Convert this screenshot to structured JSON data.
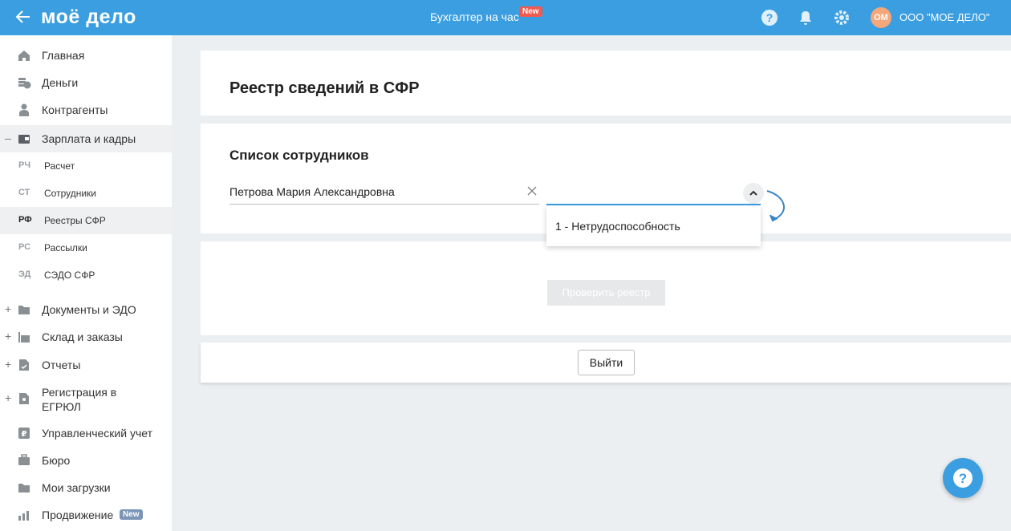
{
  "header": {
    "logo": "моё дело",
    "center_link": "Бухгалтер на час",
    "new_badge": "New",
    "avatar_initials": "ОМ",
    "company": "ООО \"МОЕ ДЕЛО\"",
    "accent": "#3a9ee0"
  },
  "sidebar": {
    "items": [
      {
        "label": "Главная",
        "icon": "home-icon"
      },
      {
        "label": "Деньги",
        "icon": "money-icon"
      },
      {
        "label": "Контрагенты",
        "icon": "contractors-icon"
      },
      {
        "label": "Зарплата и кадры",
        "icon": "wallet-icon",
        "expand": "–"
      }
    ],
    "subitems": [
      {
        "abbr": "РЧ",
        "label": "Расчет"
      },
      {
        "abbr": "СТ",
        "label": "Сотрудники"
      },
      {
        "abbr": "РФ",
        "label": "Реестры СФР"
      },
      {
        "abbr": "РС",
        "label": "Рассылки"
      },
      {
        "abbr": "ЭД",
        "label": "СЭДО СФР"
      }
    ],
    "items2": [
      {
        "label": "Документы и ЭДО",
        "icon": "folder-icon",
        "expand": "+"
      },
      {
        "label": "Склад и заказы",
        "icon": "warehouse-icon",
        "expand": "+"
      },
      {
        "label": "Отчеты",
        "icon": "report-icon",
        "expand": "+"
      },
      {
        "label": "Регистрация в ЕГРЮЛ",
        "icon": "registration-icon",
        "expand": "+"
      },
      {
        "label": "Управленческий учет",
        "icon": "ruble-icon"
      },
      {
        "label": "Бюро",
        "icon": "briefcase-icon"
      },
      {
        "label": "Мои загрузки",
        "icon": "downloads-icon"
      },
      {
        "label": "Продвижение",
        "icon": "promotion-icon",
        "badge": "New"
      }
    ]
  },
  "main": {
    "title": "Реестр сведений в СФР",
    "section_title": "Список сотрудников",
    "employee_value": "Петрова Мария Александровна",
    "dropdown_option": "1 - Нетрудоспособность",
    "check_button": "Проверить реестр",
    "exit_button": "Выйти"
  }
}
